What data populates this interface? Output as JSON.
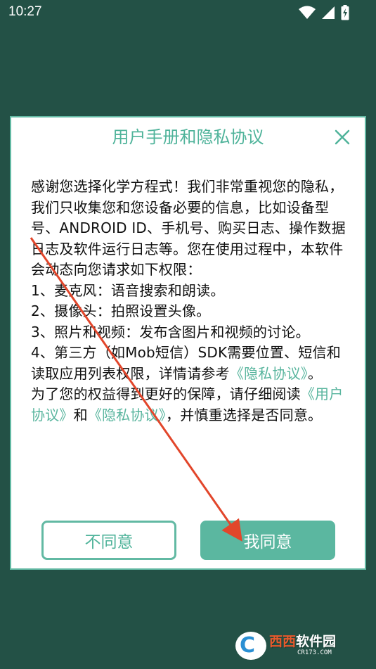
{
  "status_bar": {
    "time": "10:27",
    "icons": [
      "wifi-icon",
      "signal-icon",
      "battery-charging-icon"
    ]
  },
  "dialog": {
    "title": "用户手册和隐私协议",
    "paragraphs": [
      "感谢您选择化学方程式！我们非常重视您的隐私，我们只收集您和您设备必要的信息，比如设备型号、ANDROID ID、手机号、购买日志、操作数据日志及软件运行日志等。您在使用过程中，本软件会动态向您请求如下权限：",
      "1、麦克风：语音搜索和朗读。",
      "2、摄像头：拍照设置头像。",
      "3、照片和视频：发布含图片和视频的讨论。",
      "4、第三方（如Mob短信）SDK需要位置、短信和读取应用列表权限，详情请参考"
    ],
    "privacy_link_1": "《隐私协议》",
    "after_link_1": "。",
    "closing_prefix": "为了您的权益得到更好的保障，请仔细阅读",
    "user_link": "《用户协议》",
    "and_text": "和",
    "privacy_link_2": "《隐私协议》",
    "closing_suffix": "，并慎重选择是否同意。",
    "disagree_label": "不同意",
    "agree_label": "我同意"
  },
  "watermark": {
    "logo_letter": "C",
    "main_red": "西西",
    "main_white": "软件园",
    "sub": "CR173.COM"
  },
  "colors": {
    "background": "#235146",
    "accent": "#5bb7a0",
    "arrow": "#e2462b"
  }
}
